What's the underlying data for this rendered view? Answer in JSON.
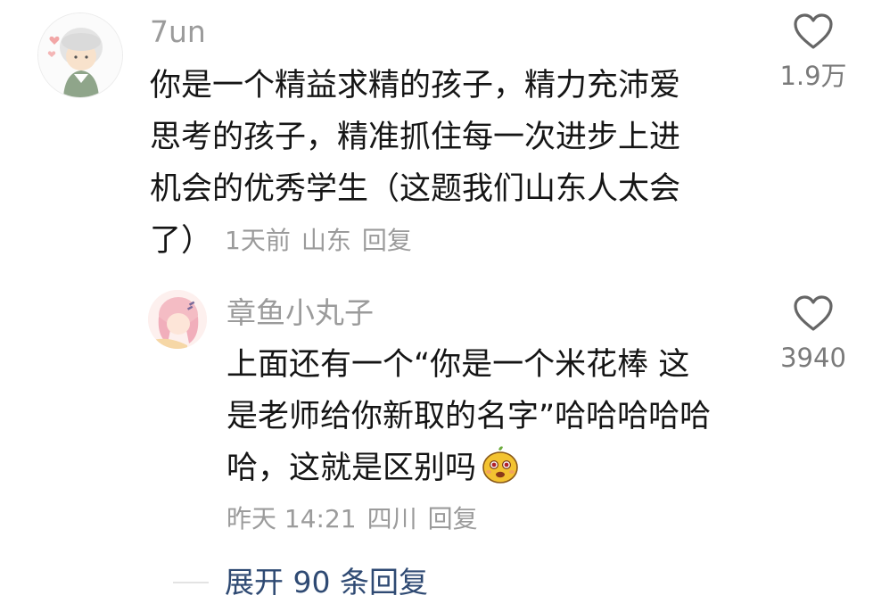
{
  "comments": [
    {
      "username": "7un",
      "text_lines": [
        "你是一个精益求精的孩子，精力充沛爱",
        "思考的孩子，精准抓住每一次进步上进",
        "机会的优秀学生（这题我们山东人太会",
        "了）"
      ],
      "time": "1天前",
      "location": "山东",
      "reply_label": "回复",
      "likes": "1.9万"
    },
    {
      "username": "章鱼小丸子",
      "text_lines": [
        "上面还有一个“你是一个米花棒 这",
        "是老师给你新取的名字”哈哈哈哈哈",
        "哈，这就是区别吗"
      ],
      "time": "昨天 14:21",
      "location": "四川",
      "reply_label": "回复",
      "likes": "3940"
    }
  ],
  "expand_replies": {
    "label": "展开 90 条回复"
  },
  "icons": {
    "like": "heart-outline-icon",
    "emoji": "smiling-sticker-emoji"
  },
  "colors": {
    "text": "#151515",
    "muted": "#9b9b9b",
    "link": "#2f4a73",
    "like_icon": "#666666"
  }
}
